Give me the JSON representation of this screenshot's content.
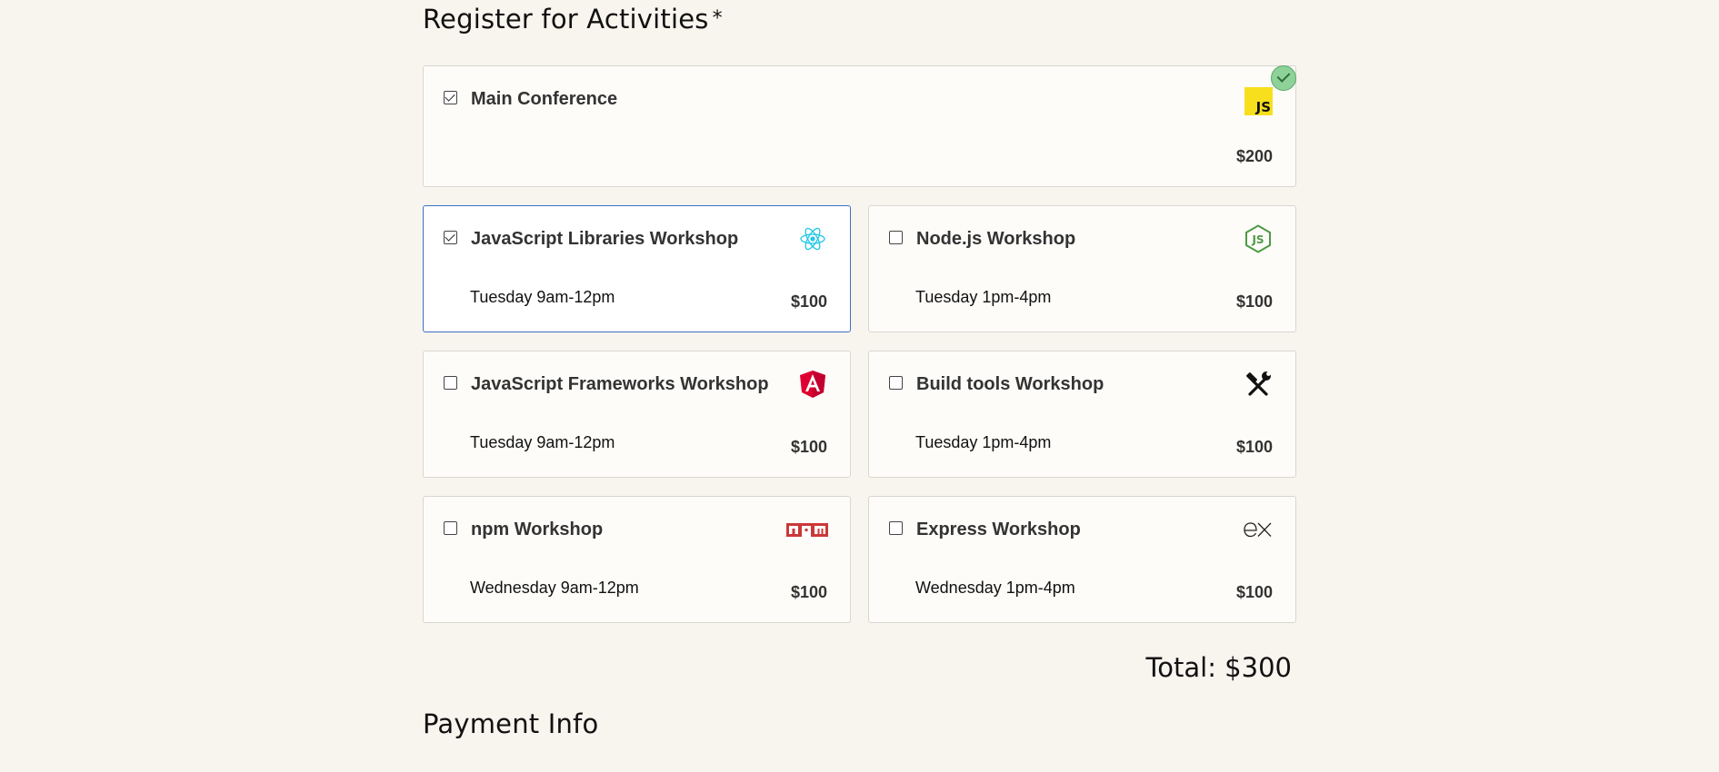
{
  "activities": {
    "title": "Register for Activities",
    "required_mark": "*",
    "main": {
      "name": "Main Conference",
      "price": "$200",
      "checked": true,
      "logo": "js-logo",
      "logo_text": "JS"
    },
    "workshops": [
      {
        "name": "JavaScript Libraries Workshop",
        "time": "Tuesday 9am-12pm",
        "price": "$100",
        "checked": true,
        "logo": "react-icon"
      },
      {
        "name": "Node.js Workshop",
        "time": "Tuesday 1pm-4pm",
        "price": "$100",
        "checked": false,
        "logo": "nodejs-icon"
      },
      {
        "name": "JavaScript Frameworks Workshop",
        "time": "Tuesday 9am-12pm",
        "price": "$100",
        "checked": false,
        "logo": "angular-icon"
      },
      {
        "name": "Build tools Workshop",
        "time": "Tuesday 1pm-4pm",
        "price": "$100",
        "checked": false,
        "logo": "tools-icon"
      },
      {
        "name": "npm Workshop",
        "time": "Wednesday 9am-12pm",
        "price": "$100",
        "checked": false,
        "logo": "npm-icon"
      },
      {
        "name": "Express Workshop",
        "time": "Wednesday 1pm-4pm",
        "price": "$100",
        "checked": false,
        "logo": "express-icon"
      }
    ],
    "total": "Total: $300"
  },
  "payment": {
    "title": "Payment Info"
  },
  "colors": {
    "background": "#f8f4ee",
    "focus_border": "#3f6fc4",
    "badge_green": "#8ed29a",
    "react": "#1ec8e6",
    "node": "#4e9a45",
    "angular": "#dd0031",
    "npm": "#cb3837"
  }
}
